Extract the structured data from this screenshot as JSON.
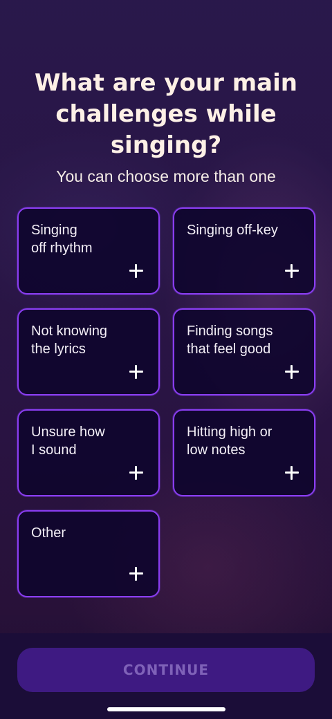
{
  "header": {
    "title": "What are your main challenges while singing?",
    "subtitle": "You can choose more than one"
  },
  "options": [
    {
      "label": "Singing\noff rhythm",
      "icon": "plus-icon"
    },
    {
      "label": "Singing off-key",
      "icon": "plus-icon"
    },
    {
      "label": "Not knowing\nthe lyrics",
      "icon": "plus-icon"
    },
    {
      "label": "Finding songs\nthat feel good",
      "icon": "plus-icon"
    },
    {
      "label": "Unsure how\nI sound",
      "icon": "plus-icon"
    },
    {
      "label": "Hitting high or\nlow notes",
      "icon": "plus-icon"
    },
    {
      "label": "Other",
      "icon": "plus-icon"
    }
  ],
  "footer": {
    "continue_label": "CONTINUE",
    "continue_enabled": false
  },
  "colors": {
    "accent_border": "#8a3df0",
    "card_bg": "#0e042c",
    "button_bg": "#3e1a82",
    "button_text_disabled": "#7f62b8",
    "title_text": "#fdf0e6"
  }
}
